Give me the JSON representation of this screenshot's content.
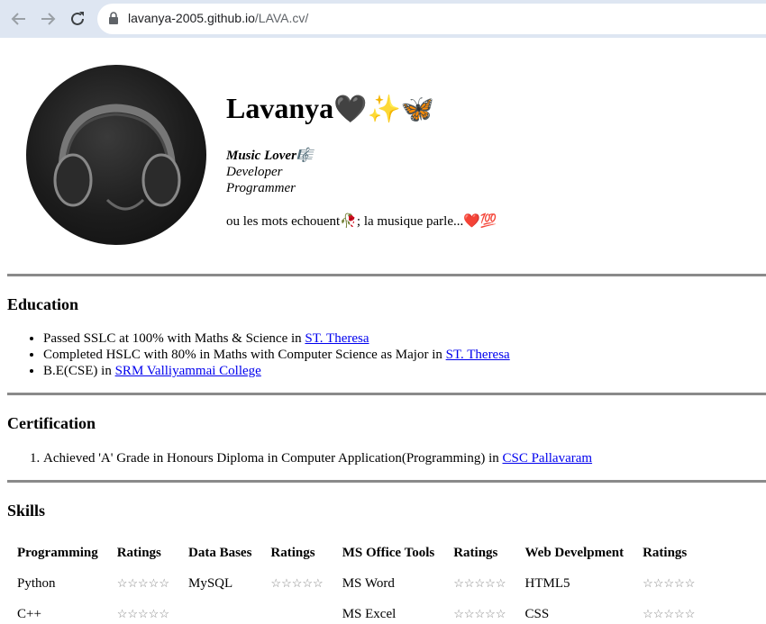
{
  "browser": {
    "url_domain": "lavanya-2005.github.io",
    "url_path": "/LAVA.cv/"
  },
  "profile": {
    "name": "Lavanya",
    "name_emojis": "🖤✨🦋",
    "tag_music": "Music Lover",
    "tag_music_emoji": "🎼",
    "tag_developer": "Developer",
    "tag_programmer": "Programmer",
    "quote_part1": "ou les mots echouent",
    "quote_emoji1": "🥀",
    "quote_part2": "; la musique parle...",
    "quote_emoji2": "❤️💯"
  },
  "education": {
    "heading": "Education",
    "items": [
      {
        "text": "Passed SSLC at 100% with Maths & Science in ",
        "link": "ST. Theresa"
      },
      {
        "text": "Completed HSLC with 80% in Maths with Computer Science as Major in ",
        "link": "ST. Theresa"
      },
      {
        "text": "B.E(CSE) in ",
        "link": "SRM Valliyammai College"
      }
    ]
  },
  "certification": {
    "heading": "Certification",
    "items": [
      {
        "text": "Achieved 'A' Grade in Honours Diploma in Computer Application(Programming) in ",
        "link": "CSC Pallavaram"
      }
    ]
  },
  "skills": {
    "heading": "Skills",
    "headers": [
      "Programming",
      "Ratings",
      "Data Bases",
      "Ratings",
      "MS Office Tools",
      "Ratings",
      "Web Develpment",
      "Ratings"
    ],
    "rows": [
      [
        "Python",
        "☆☆☆☆☆",
        "MySQL",
        "☆☆☆☆☆",
        "MS Word",
        "☆☆☆☆☆",
        "HTML5",
        "☆☆☆☆☆"
      ],
      [
        "C++",
        "☆☆☆☆☆",
        "",
        "",
        "MS Excel",
        "☆☆☆☆☆",
        "CSS",
        "☆☆☆☆☆"
      ]
    ]
  }
}
